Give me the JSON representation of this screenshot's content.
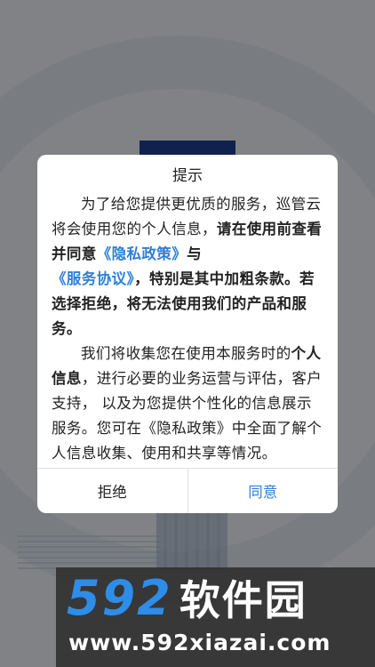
{
  "dialog": {
    "title": "提示",
    "paragraph1": {
      "segments": [
        {
          "text": "为了给您提供更优质的服务，巡管云将会使用您的个人信息，",
          "style": "normal"
        },
        {
          "text": "请在使用前查看并同意",
          "style": "bold"
        },
        {
          "text": "《隐私政策》",
          "style": "link"
        },
        {
          "text": "与",
          "style": "bold"
        },
        {
          "text": "《服务协议》",
          "style": "link"
        },
        {
          "text": "，特别是其中加粗条款。若选择拒绝，将无法使用我们的产品和服务。",
          "style": "bold"
        }
      ]
    },
    "paragraph2": {
      "segments": [
        {
          "text": "我们将收集您在使用本服务时的",
          "style": "normal"
        },
        {
          "text": "个人信息",
          "style": "bold"
        },
        {
          "text": "，进行必要的业务运营与评估，客户支持， 以及为您提供个性化的信息展示服务。您可在《隐私政策》中全面了解个人信息收集、使用和共享等情况。",
          "style": "normal"
        }
      ]
    },
    "reject_label": "拒绝",
    "agree_label": "同意"
  },
  "watermark": {
    "number": "592",
    "name": "软件园",
    "url": "www.592xiazai.com"
  },
  "colors": {
    "accent": "#2f7fd6",
    "watermark_blue": "#2d8de8",
    "overlay": "rgba(0,0,0,0.45)"
  }
}
